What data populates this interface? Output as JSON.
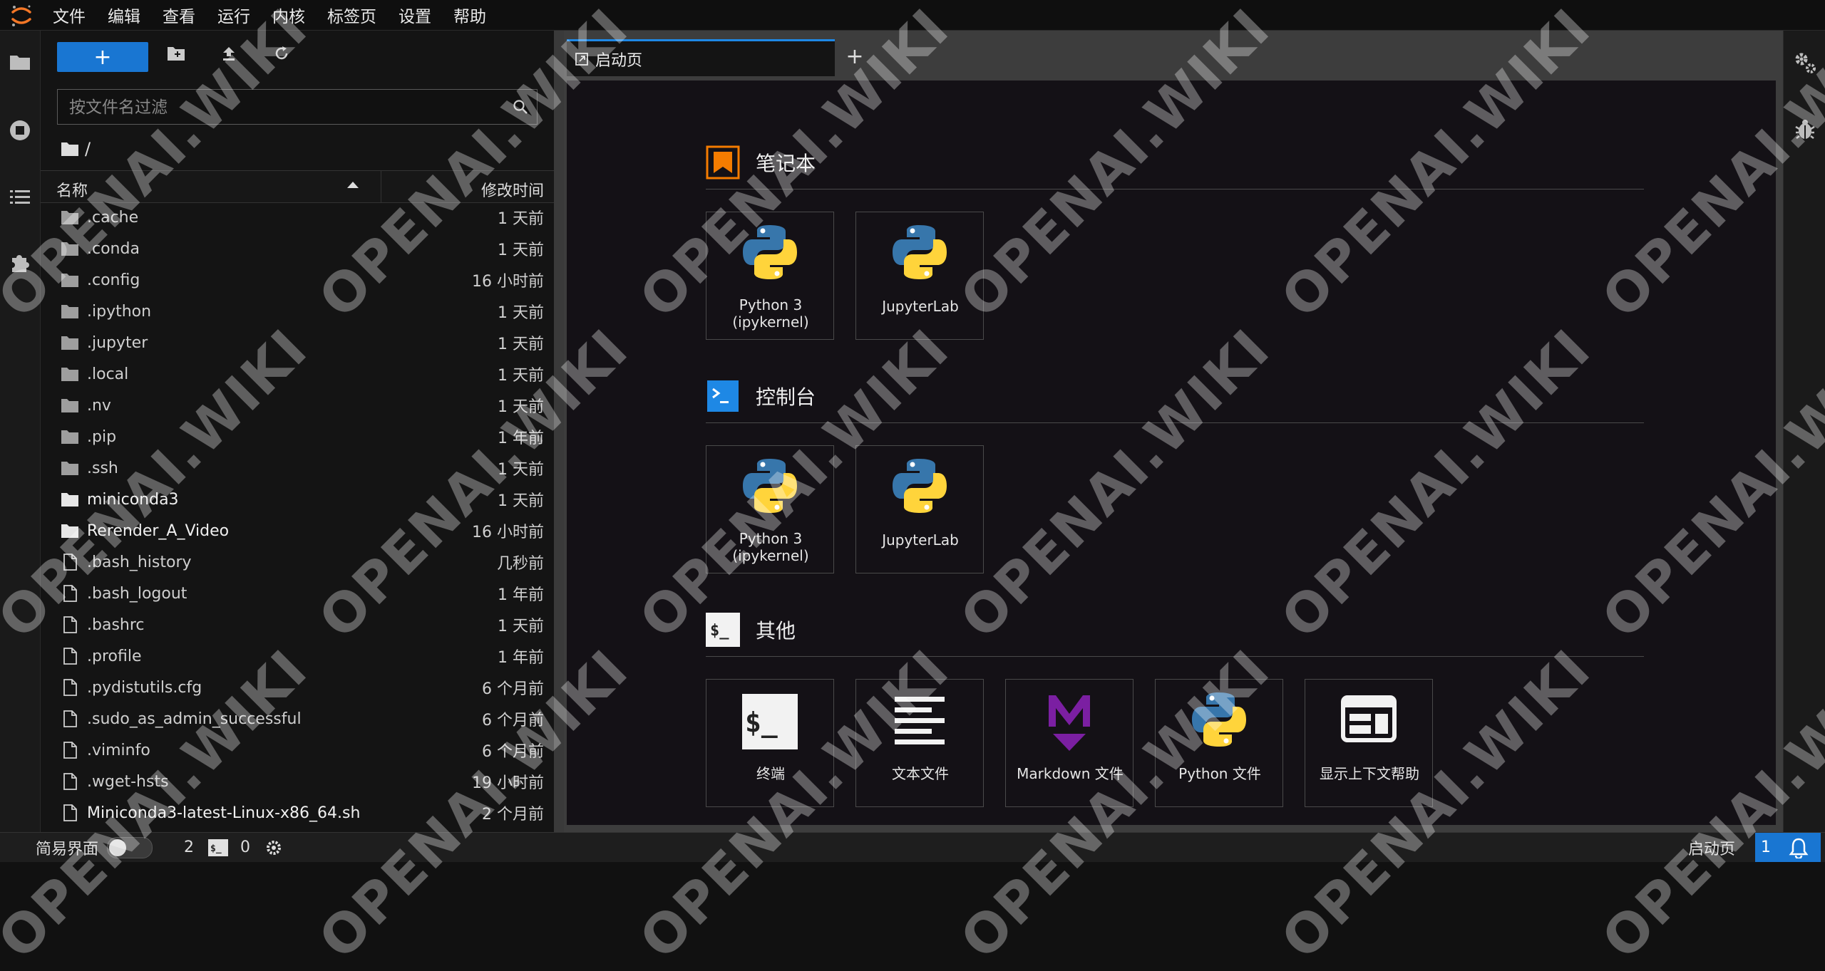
{
  "menubar": {
    "items": [
      "文件",
      "编辑",
      "查看",
      "运行",
      "内核",
      "标签页",
      "设置",
      "帮助"
    ]
  },
  "filebrowser": {
    "new_button": "+",
    "filter_placeholder": "按文件名过滤",
    "breadcrumb": "/",
    "columns": {
      "name": "名称",
      "modified": "修改时间"
    },
    "rows": [
      {
        "name": ".cache",
        "modified": "1 天前",
        "type": "folder"
      },
      {
        "name": ".conda",
        "modified": "1 天前",
        "type": "folder"
      },
      {
        "name": ".config",
        "modified": "16 小时前",
        "type": "folder"
      },
      {
        "name": ".ipython",
        "modified": "1 天前",
        "type": "folder"
      },
      {
        "name": ".jupyter",
        "modified": "1 天前",
        "type": "folder"
      },
      {
        "name": ".local",
        "modified": "1 天前",
        "type": "folder"
      },
      {
        "name": ".nv",
        "modified": "1 天前",
        "type": "folder"
      },
      {
        "name": ".pip",
        "modified": "1 年前",
        "type": "folder"
      },
      {
        "name": ".ssh",
        "modified": "1 天前",
        "type": "folder"
      },
      {
        "name": "miniconda3",
        "modified": "1 天前",
        "type": "folder"
      },
      {
        "name": "Rerender_A_Video",
        "modified": "16 小时前",
        "type": "folder"
      },
      {
        "name": ".bash_history",
        "modified": "几秒前",
        "type": "file"
      },
      {
        "name": ".bash_logout",
        "modified": "1 年前",
        "type": "file"
      },
      {
        "name": ".bashrc",
        "modified": "1 天前",
        "type": "file"
      },
      {
        "name": ".profile",
        "modified": "1 年前",
        "type": "file"
      },
      {
        "name": ".pydistutils.cfg",
        "modified": "6 个月前",
        "type": "file"
      },
      {
        "name": ".sudo_as_admin_successful",
        "modified": "6 个月前",
        "type": "file"
      },
      {
        "name": ".viminfo",
        "modified": "6 个月前",
        "type": "file"
      },
      {
        "name": ".wget-hsts",
        "modified": "19 小时前",
        "type": "file"
      },
      {
        "name": "Miniconda3-latest-Linux-x86_64.sh",
        "modified": "2 个月前",
        "type": "file"
      }
    ]
  },
  "tabs": {
    "launcher": "启动页",
    "add": "+"
  },
  "launcher": {
    "notebook": {
      "title": "笔记本",
      "cards": [
        {
          "label": "Python 3 (ipykernel)",
          "icon": "python-logo"
        },
        {
          "label": "JupyterLab",
          "icon": "python-logo"
        }
      ]
    },
    "console": {
      "title": "控制台",
      "cards": [
        {
          "label": "Python 3 (ipykernel)",
          "icon": "python-logo"
        },
        {
          "label": "JupyterLab",
          "icon": "python-logo"
        }
      ]
    },
    "other": {
      "title": "其他",
      "cards": [
        {
          "label": "终端",
          "icon": "terminal-icon"
        },
        {
          "label": "文本文件",
          "icon": "text-file-icon"
        },
        {
          "label": "Markdown 文件",
          "icon": "markdown-icon"
        },
        {
          "label": "Python 文件",
          "icon": "python-logo"
        },
        {
          "label": "显示上下文帮助",
          "icon": "context-help-icon"
        }
      ]
    }
  },
  "statusbar": {
    "simple_mode": "简易界面",
    "kernels_count": "2",
    "terminals_count": "0",
    "active_tab": "启动页",
    "notification_count": "1"
  },
  "watermark": "OPENAI.WIKI",
  "colors": {
    "accent": "#1976d2",
    "notebook_icon": "#f57c00",
    "console_icon": "#1e88e5",
    "markdown_icon": "#7b1fa2"
  }
}
